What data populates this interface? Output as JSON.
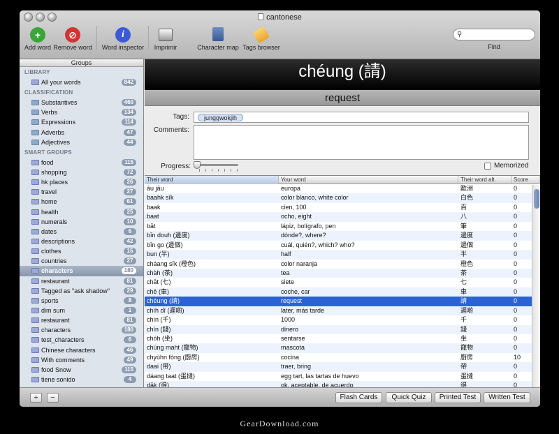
{
  "window": {
    "title": "cantonese"
  },
  "toolbar": {
    "items": [
      {
        "label": "Add word",
        "icon": "add-icon",
        "color": "#3aa53a"
      },
      {
        "label": "Remove word",
        "icon": "remove-icon",
        "color": "#d43333"
      },
      {
        "label": "Word inspector",
        "icon": "info-icon",
        "color": "#3d5ad6"
      },
      {
        "label": "Imprimir",
        "icon": "printer-icon"
      },
      {
        "label": "Character map",
        "icon": "hammer-icon"
      },
      {
        "label": "Tags browser",
        "icon": "tag-icon"
      }
    ],
    "find_label": "Find",
    "search_placeholder": ""
  },
  "sidebar": {
    "header": "Groups",
    "library_header": "LIBRARY",
    "library": [
      {
        "label": "All your words",
        "count": "842"
      }
    ],
    "classification_header": "CLASSIFICATION",
    "classification": [
      {
        "label": "Substantives",
        "count": "460"
      },
      {
        "label": "Verbs",
        "count": "134"
      },
      {
        "label": "Expressions",
        "count": "114"
      },
      {
        "label": "Adverbs",
        "count": "47"
      },
      {
        "label": "Adjectives",
        "count": "44"
      }
    ],
    "smart_header": "SMART GROUPS",
    "smart": [
      {
        "label": "food",
        "count": "115"
      },
      {
        "label": "shopping",
        "count": "72"
      },
      {
        "label": "hk places",
        "count": "26"
      },
      {
        "label": "travel",
        "count": "27"
      },
      {
        "label": "home",
        "count": "61"
      },
      {
        "label": "health",
        "count": "25"
      },
      {
        "label": "numerals",
        "count": "10"
      },
      {
        "label": "dates",
        "count": "6"
      },
      {
        "label": "descriptions",
        "count": "42"
      },
      {
        "label": "clothes",
        "count": "15"
      },
      {
        "label": "countries",
        "count": "27"
      },
      {
        "label": "characters",
        "count": "180",
        "selected": true
      },
      {
        "label": "restaurant",
        "count": "81"
      },
      {
        "label": "Tagged as \"ask shadow\"",
        "count": "29"
      },
      {
        "label": "sports",
        "count": "8"
      },
      {
        "label": "dim sum",
        "count": "1"
      },
      {
        "label": "restaurant",
        "count": "81"
      },
      {
        "label": "characters",
        "count": "180"
      },
      {
        "label": "test_characters",
        "count": "6"
      },
      {
        "label": "Chinese characters",
        "count": "46"
      },
      {
        "label": "With comments",
        "count": "49"
      },
      {
        "label": "food Snow",
        "count": "115"
      },
      {
        "label": "tiene sonido",
        "count": "4"
      }
    ]
  },
  "detail": {
    "word": "chéung (請)",
    "translation": "request",
    "tags_label": "Tags:",
    "tag": "junggwokjih",
    "comments_label": "Comments:",
    "progress_label": "Progress:",
    "progress": 0,
    "memorized_label": "Memorized",
    "memorized": false
  },
  "table": {
    "columns": [
      "Their word",
      "Your word",
      "Their word alt.",
      "Score"
    ],
    "selected_row": 13,
    "rows": [
      [
        "āu jāu",
        "europa",
        "歐洲",
        "0"
      ],
      [
        "baahk sīk",
        "color blanco, white color",
        "白色",
        "0"
      ],
      [
        "baak",
        "cien, 100",
        "百",
        "0"
      ],
      [
        "baat",
        "ocho, eight",
        "八",
        "0"
      ],
      [
        "bāt",
        "lápiz, bolígrafo, pen",
        "筆",
        "0"
      ],
      [
        "bīn douh (邊度)",
        "dónde?, where?",
        "邊度",
        "0"
      ],
      [
        "bīn go (邊個)",
        "cuál, quién?, which? who?",
        "邊個",
        "0"
      ],
      [
        "bun (半)",
        "half",
        "半",
        "0"
      ],
      [
        "cháang sīk (橙色)",
        "color naranja",
        "橙色",
        "0"
      ],
      [
        "chàh (茶)",
        "tea",
        "茶",
        "0"
      ],
      [
        "chāt (七)",
        "siete",
        "七",
        "0"
      ],
      [
        "chē (車)",
        "coche, car",
        "車",
        "0"
      ],
      [
        "chéung (請)",
        "request",
        "請",
        "0"
      ],
      [
        "chìh dī (遲啲)",
        "later, más tarde",
        "遲啲",
        "0"
      ],
      [
        "chìn (千)",
        "1000",
        "千",
        "0"
      ],
      [
        "chín (錢)",
        "dinero",
        "錢",
        "0"
      ],
      [
        "chóh (坐)",
        "sentarse",
        "坐",
        "0"
      ],
      [
        "chúng maht (寵物)",
        "mascota",
        "寵物",
        "0"
      ],
      [
        "chyùhn fóng (廚房)",
        "cocina",
        "廚房",
        "10"
      ],
      [
        "daai (帶)",
        "traer, bring",
        "帶",
        "0"
      ],
      [
        "dáang taat (蛋撻)",
        "egg tart, las tartas de huevo",
        "蛋撻",
        "0"
      ],
      [
        "dāk (得)",
        "ok, aceptable, de acuerdo",
        "得",
        "0"
      ]
    ]
  },
  "bottom": {
    "add": "+",
    "remove": "−",
    "buttons": [
      "Flash Cards",
      "Quick Quiz",
      "Printed Test",
      "Written Test"
    ]
  },
  "footer": "GearDownload.com"
}
